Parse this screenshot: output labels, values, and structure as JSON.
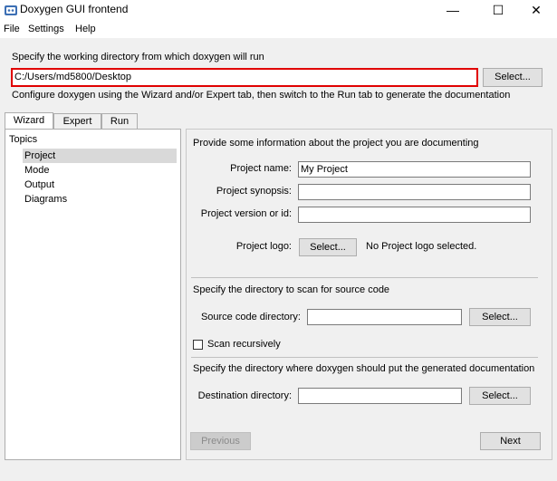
{
  "window": {
    "title": "Doxygen GUI frontend",
    "minimize_glyph": "—",
    "maximize_glyph": "☐",
    "close_glyph": "✕"
  },
  "menu": [
    "File",
    "Settings",
    "Help"
  ],
  "workdir": {
    "label": "Specify the working directory from which doxygen will run",
    "value": "C:/Users/md5800/Desktop",
    "select_label": "Select...",
    "highlight_color": "#e00000"
  },
  "configure_text": "Configure doxygen using the Wizard and/or Expert tab, then switch to the Run tab to generate the documentation",
  "tabs": [
    "Wizard",
    "Expert",
    "Run"
  ],
  "topics": {
    "header": "Topics",
    "items": [
      "Project",
      "Mode",
      "Output",
      "Diagrams"
    ],
    "selected": "Project"
  },
  "project": {
    "intro": "Provide some information about the project you are documenting",
    "name_label": "Project name:",
    "name_value": "My Project",
    "synopsis_label": "Project synopsis:",
    "synopsis_value": "",
    "version_label": "Project version or id:",
    "version_value": "",
    "logo_label": "Project logo:",
    "logo_button": "Select...",
    "logo_status": "No Project logo selected."
  },
  "source": {
    "intro": "Specify the directory to scan for source code",
    "dir_label": "Source code directory:",
    "dir_value": "",
    "select_label": "Select...",
    "recursive_label": "Scan recursively"
  },
  "destination": {
    "intro": "Specify the directory where doxygen should put the generated documentation",
    "dir_label": "Destination directory:",
    "dir_value": "",
    "select_label": "Select..."
  },
  "nav": {
    "previous_label": "Previous",
    "next_label": "Next"
  }
}
